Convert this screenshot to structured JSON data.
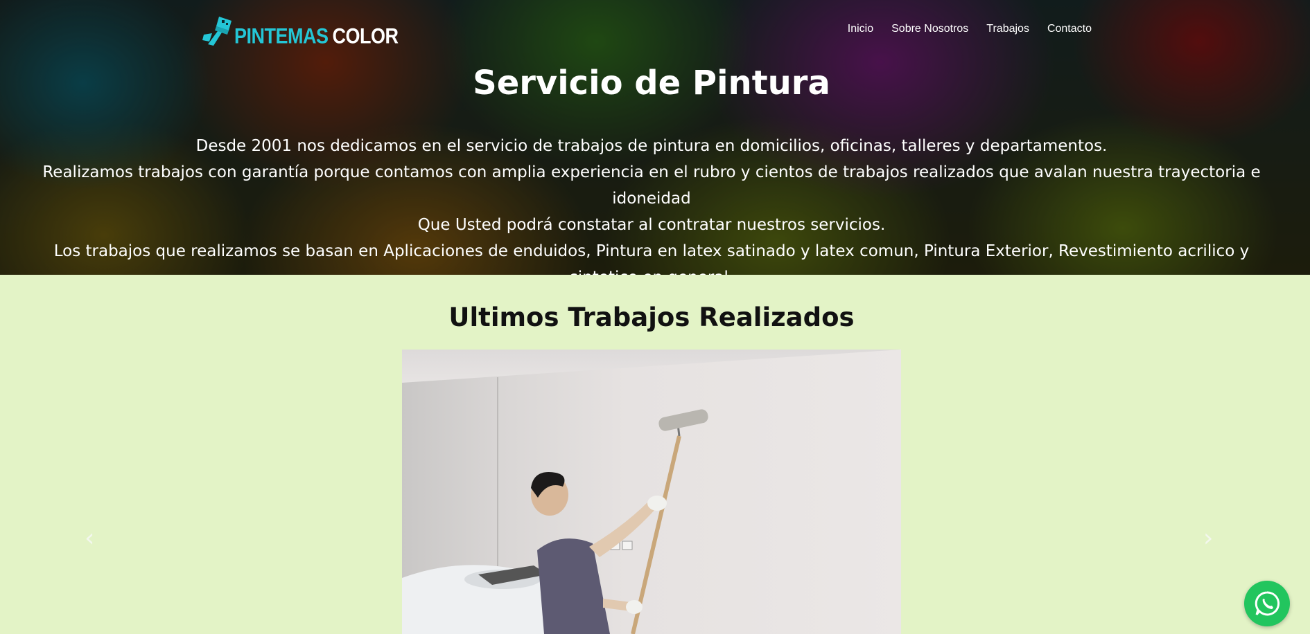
{
  "brand": {
    "logo_text_1": "PINTEMAS",
    "logo_text_2": "COLOR",
    "logo_accent_color": "#24c6d6"
  },
  "nav": {
    "items": [
      "Inicio",
      "Sobre Nosotros",
      "Trabajos",
      "Contacto"
    ]
  },
  "hero": {
    "title": "Servicio de Pintura",
    "lines": [
      "Desde 2001 nos dedicamos en el servicio de trabajos de pintura en domicilios, oficinas, talleres y departamentos.",
      "Realizamos trabajos con garantía porque contamos con amplia experiencia en el rubro y cientos de trabajos realizados que avalan nuestra trayectoria e idoneidad",
      "Que Usted podrá constatar al contratar nuestros servicios.",
      "Los trabajos que realizamos se basan en Aplicaciones de enduidos, Pintura en latex satinado y latex comun, Pintura Exterior, Revestimiento acrilico y sintetico en general."
    ]
  },
  "works": {
    "title": "Ultimos Trabajos Realizados",
    "prev_glyph": "‹",
    "next_glyph": "›"
  },
  "icons": {
    "brush": "paint-brush-icon",
    "whatsapp": "whatsapp-icon",
    "prev": "chevron-left-icon",
    "next": "chevron-right-icon"
  },
  "colors": {
    "section_bg": "#e3f3c6",
    "whatsapp_green": "#22c55e"
  }
}
